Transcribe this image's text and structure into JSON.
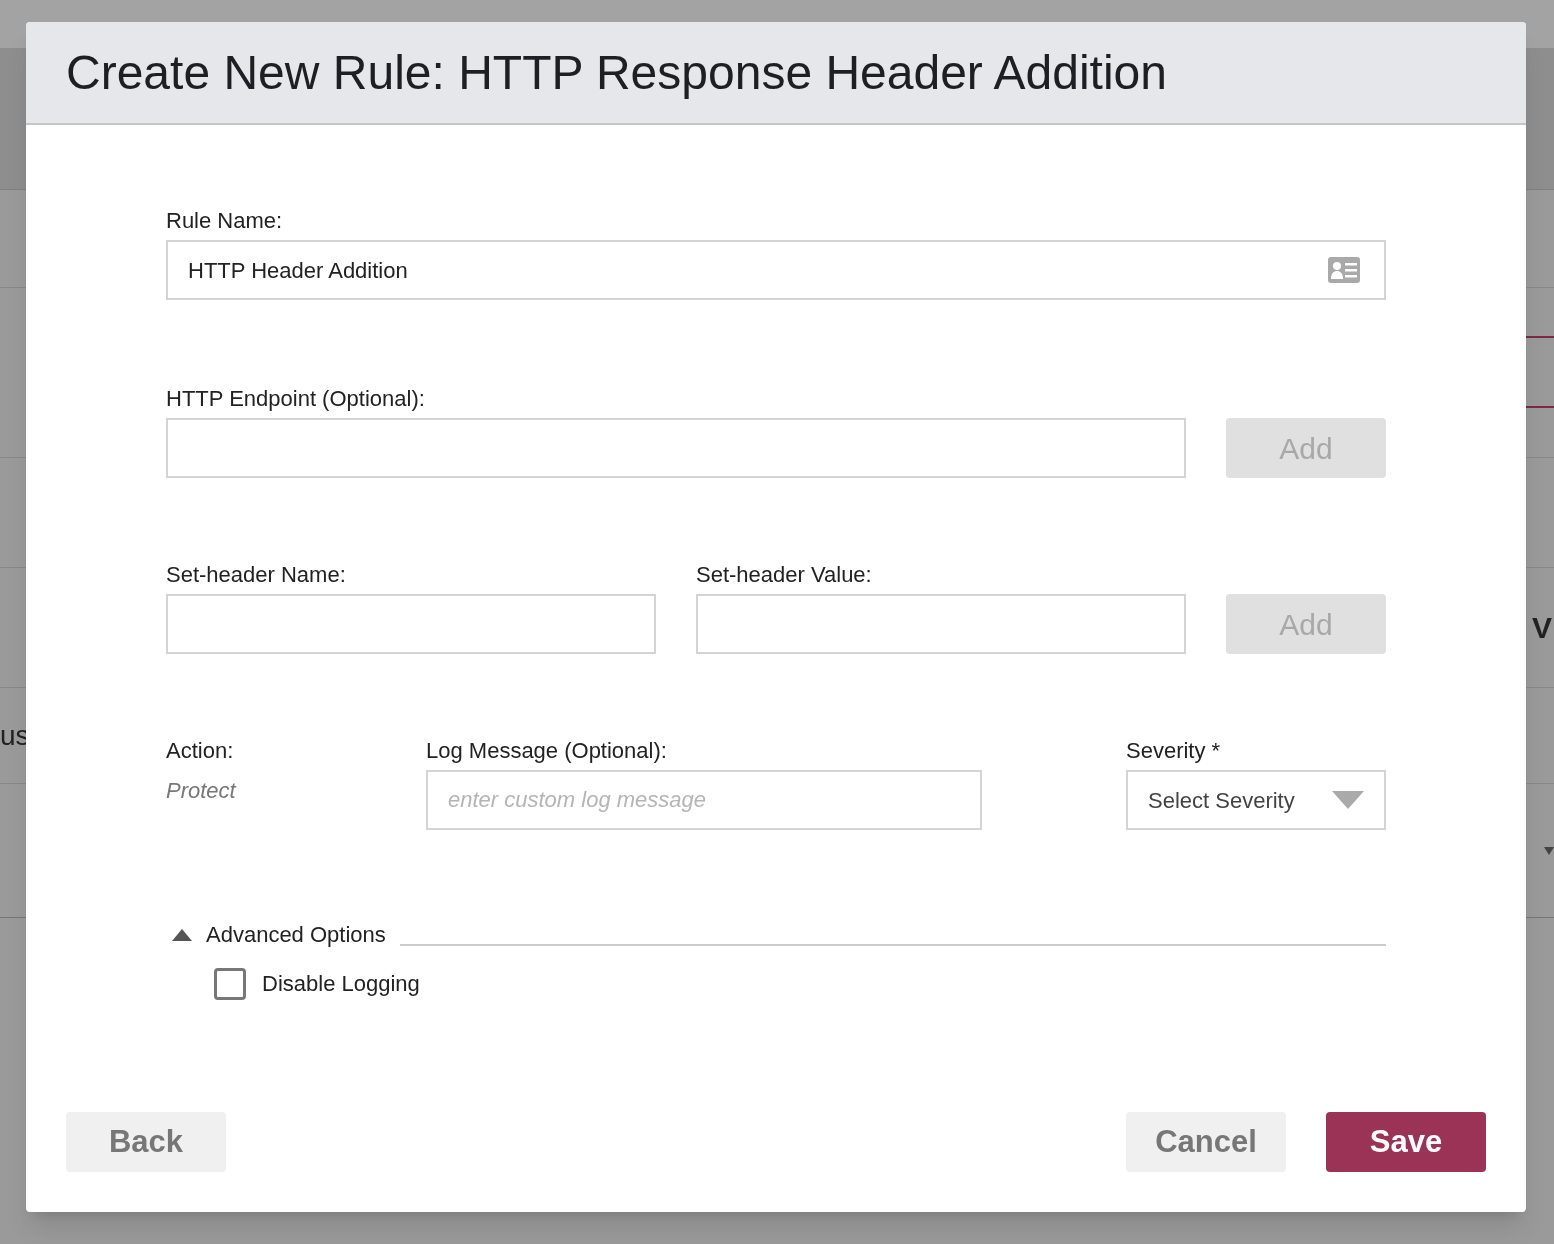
{
  "background": {
    "left_text": "us",
    "right_text": "V"
  },
  "dialog": {
    "title": "Create New Rule: HTTP Response Header Addition",
    "rule_name": {
      "label": "Rule Name:",
      "value": "HTTP Header Addition"
    },
    "endpoint": {
      "label": "HTTP Endpoint (Optional):",
      "button": {
        "label": "Add",
        "disabled": true
      }
    },
    "set_header": {
      "name_label": "Set-header Name:",
      "value_label": "Set-header Value:",
      "button": {
        "label": "Add",
        "disabled": true
      }
    },
    "action": {
      "label": "Action:",
      "value": "Protect"
    },
    "log_message": {
      "label": "Log Message (Optional):",
      "placeholder": "enter custom log message"
    },
    "severity": {
      "label": "Severity *",
      "value": "Select Severity"
    },
    "advanced": {
      "label": "Advanced Options",
      "expanded": true,
      "options": [
        {
          "label": "Disable Logging",
          "checked": false
        }
      ]
    },
    "footer": [
      {
        "label": "Back",
        "kind": "secondary"
      },
      {
        "label": "Cancel",
        "kind": "secondary"
      },
      {
        "label": "Save",
        "kind": "primary"
      }
    ]
  }
}
